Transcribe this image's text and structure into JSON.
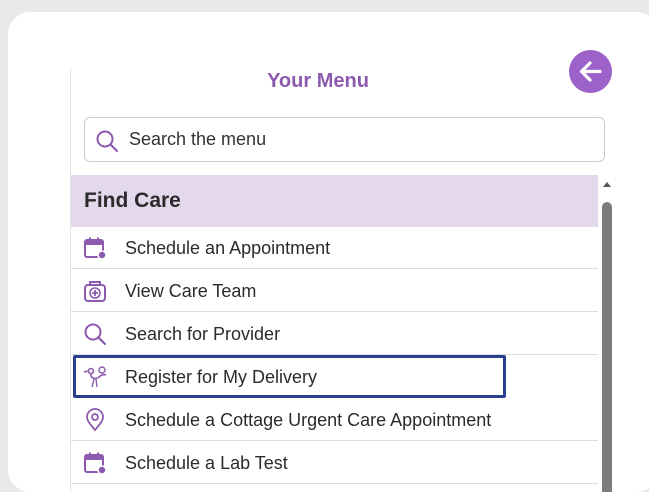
{
  "menu": {
    "title": "Your Menu",
    "search_placeholder": "Search the menu",
    "section": "Find Care",
    "items": [
      {
        "label": "Schedule an Appointment",
        "icon": "calendar-icon"
      },
      {
        "label": "View Care Team",
        "icon": "medical-kit-icon"
      },
      {
        "label": "Search for Provider",
        "icon": "search-icon"
      },
      {
        "label": "Register for My Delivery",
        "icon": "stork-icon",
        "highlighted": true
      },
      {
        "label": "Schedule a Cottage Urgent Care Appointment",
        "icon": "location-pin-icon"
      },
      {
        "label": "Schedule a Lab Test",
        "icon": "calendar-icon"
      }
    ]
  },
  "colors": {
    "accent": "#9d62c9",
    "title": "#8c5bb0",
    "section_bg": "#e4d8ec",
    "highlight_border": "#2b3f8f"
  }
}
